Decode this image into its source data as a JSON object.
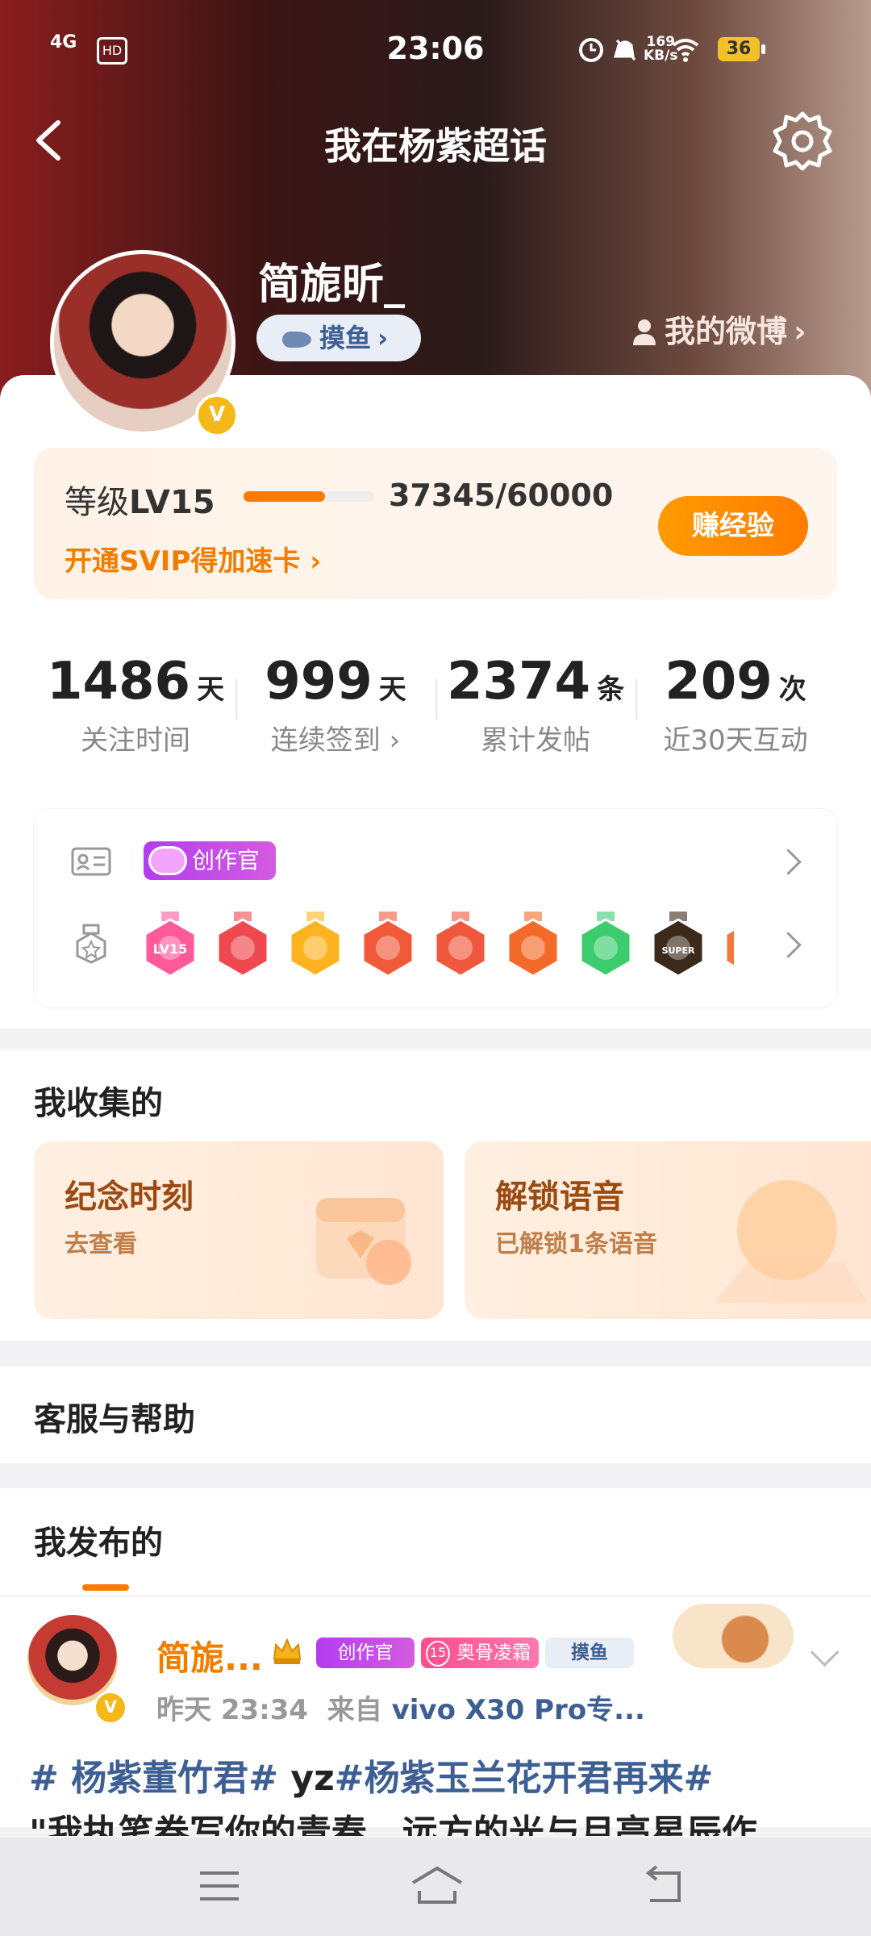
{
  "status_bar": {
    "time": "23:06",
    "network": "4G",
    "hd": "HD",
    "speed_value": "169",
    "speed_unit": "KB/s",
    "battery": "36"
  },
  "header": {
    "title": "我在杨紫超话"
  },
  "profile": {
    "username": "简旎昕_",
    "pill_label": "摸鱼",
    "my_weibo": "我的微博"
  },
  "level": {
    "label_prefix": "等级",
    "level": "LV15",
    "exp_text": "37345/60000",
    "progress": 0.622,
    "svip_link": "开通SVIP得加速卡",
    "earn_button": "赚经验"
  },
  "stats": [
    {
      "value": "1486",
      "unit": "天",
      "label": "关注时间"
    },
    {
      "value": "999",
      "unit": "天",
      "label": "连续签到"
    },
    {
      "value": "2374",
      "unit": "条",
      "label": "累计发帖"
    },
    {
      "value": "209",
      "unit": "次",
      "label": "近30天互动"
    }
  ],
  "badges": {
    "creator_tag": "创作官",
    "medals": [
      {
        "name": "lv15-medal",
        "color": "#ff5a9a",
        "text": "LV15"
      },
      {
        "name": "trophy-medal",
        "color": "#f0484f",
        "text": ""
      },
      {
        "name": "crown-medal",
        "color": "#ffb321",
        "text": ""
      },
      {
        "name": "cat-red-medal",
        "color": "#f05a3a",
        "text": ""
      },
      {
        "name": "cat-pink-medal",
        "color": "#f0583e",
        "text": ""
      },
      {
        "name": "lion-medal",
        "color": "#f36a2a",
        "text": ""
      },
      {
        "name": "hand-green-medal",
        "color": "#3ccc6e",
        "text": ""
      },
      {
        "name": "super-medal",
        "color": "#3b2a1a",
        "text": "SUPER"
      },
      {
        "name": "partial-medal",
        "color": "#f07a3a",
        "text": ""
      }
    ]
  },
  "collected": {
    "title": "我收集的",
    "cards": [
      {
        "title": "纪念时刻",
        "subtitle": "去查看"
      },
      {
        "title": "解锁语音",
        "subtitle": "已解锁1条语音"
      }
    ]
  },
  "help": {
    "title": "客服与帮助"
  },
  "posts": {
    "title": "我发布的",
    "author": "简旎...",
    "tags": [
      "创作官",
      "奥骨凌霜",
      "摸鱼"
    ],
    "tag_level": "15",
    "time": "昨天 23:34",
    "source_prefix": "来自",
    "device": "vivo X30 Pro专...",
    "line1_tag1": "# 杨紫董竹君#",
    "line1_plain": " yz",
    "line1_tag2": "#杨紫玉兰花开君再来#",
    "line2": "\"我执笔卷写你的青春，远方的光与月亮星辰作"
  }
}
